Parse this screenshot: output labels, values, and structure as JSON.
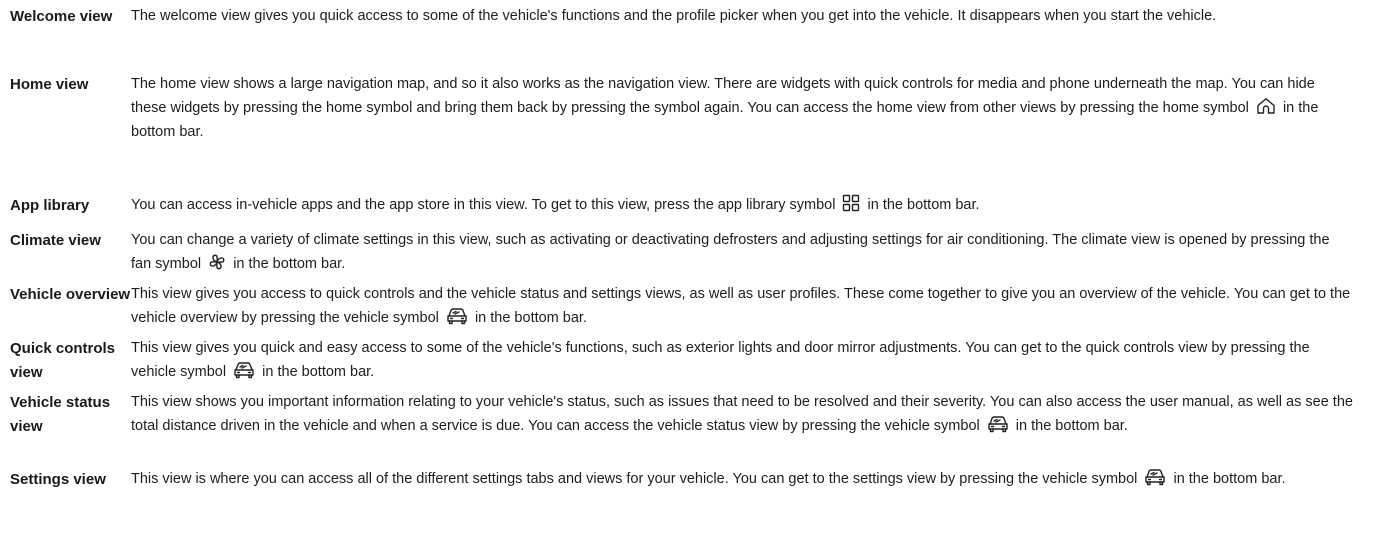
{
  "entries": {
    "welcome": {
      "term": "Welcome view",
      "text": "The welcome view gives you quick access to some of the vehicle's functions and the profile picker when you get into the vehicle. It disappears when you start the vehicle."
    },
    "home": {
      "term": "Home view",
      "text_before": "The home view shows a large navigation map, and so it also works as the navigation view. There are widgets with quick controls for media and phone underneath the map. You can hide these widgets by pressing the home symbol and bring them back by pressing the symbol again. You can access the home view from other views by pressing the home symbol",
      "text_after": "in the bottom bar.",
      "icon": "home-icon"
    },
    "app_library": {
      "term": "App library",
      "text_before": "You can access in-vehicle apps and the app store in this view. To get to this view, press the app library symbol",
      "text_after": "in the bottom bar.",
      "icon": "app-library-icon"
    },
    "climate": {
      "term": "Climate view",
      "text_before": "You can change a variety of climate settings in this view, such as activating or deactivating defrosters and adjusting settings for air conditioning. The climate view is opened by pressing the fan symbol",
      "text_after": "in the bottom bar.",
      "icon": "fan-icon"
    },
    "vehicle_overview": {
      "term": "Vehicle overview",
      "text_before": "This view gives you access to quick controls and the vehicle status and settings views, as well as user profiles. These come together to give you an overview of the vehicle. You can get to the vehicle overview by pressing the vehicle symbol",
      "text_after": "in the bottom bar.",
      "icon": "vehicle-icon"
    },
    "quick_controls": {
      "term": "Quick controls view",
      "text_before": "This view gives you quick and easy access to some of the vehicle's functions, such as exterior lights and door mirror adjustments. You can get to the quick controls view by pressing the vehicle symbol",
      "text_after": "in the bottom bar.",
      "icon": "vehicle-icon"
    },
    "vehicle_status": {
      "term": "Vehicle status view",
      "text_before": "This view shows you important information relating to your vehicle's status, such as issues that need to be resolved and their severity. You can also access the user manual, as well as see the total distance driven in the vehicle and when a service is due. You can access the vehicle status view by pressing the vehicle symbol",
      "text_after": "in the bottom bar.",
      "icon": "vehicle-icon"
    },
    "settings": {
      "term": "Settings view",
      "text_before": "This view is where you can access all of the different settings tabs and views for your vehicle. You can get to the settings view by pressing the vehicle symbol",
      "text_after": "in the bottom bar.",
      "icon": "vehicle-icon"
    }
  }
}
